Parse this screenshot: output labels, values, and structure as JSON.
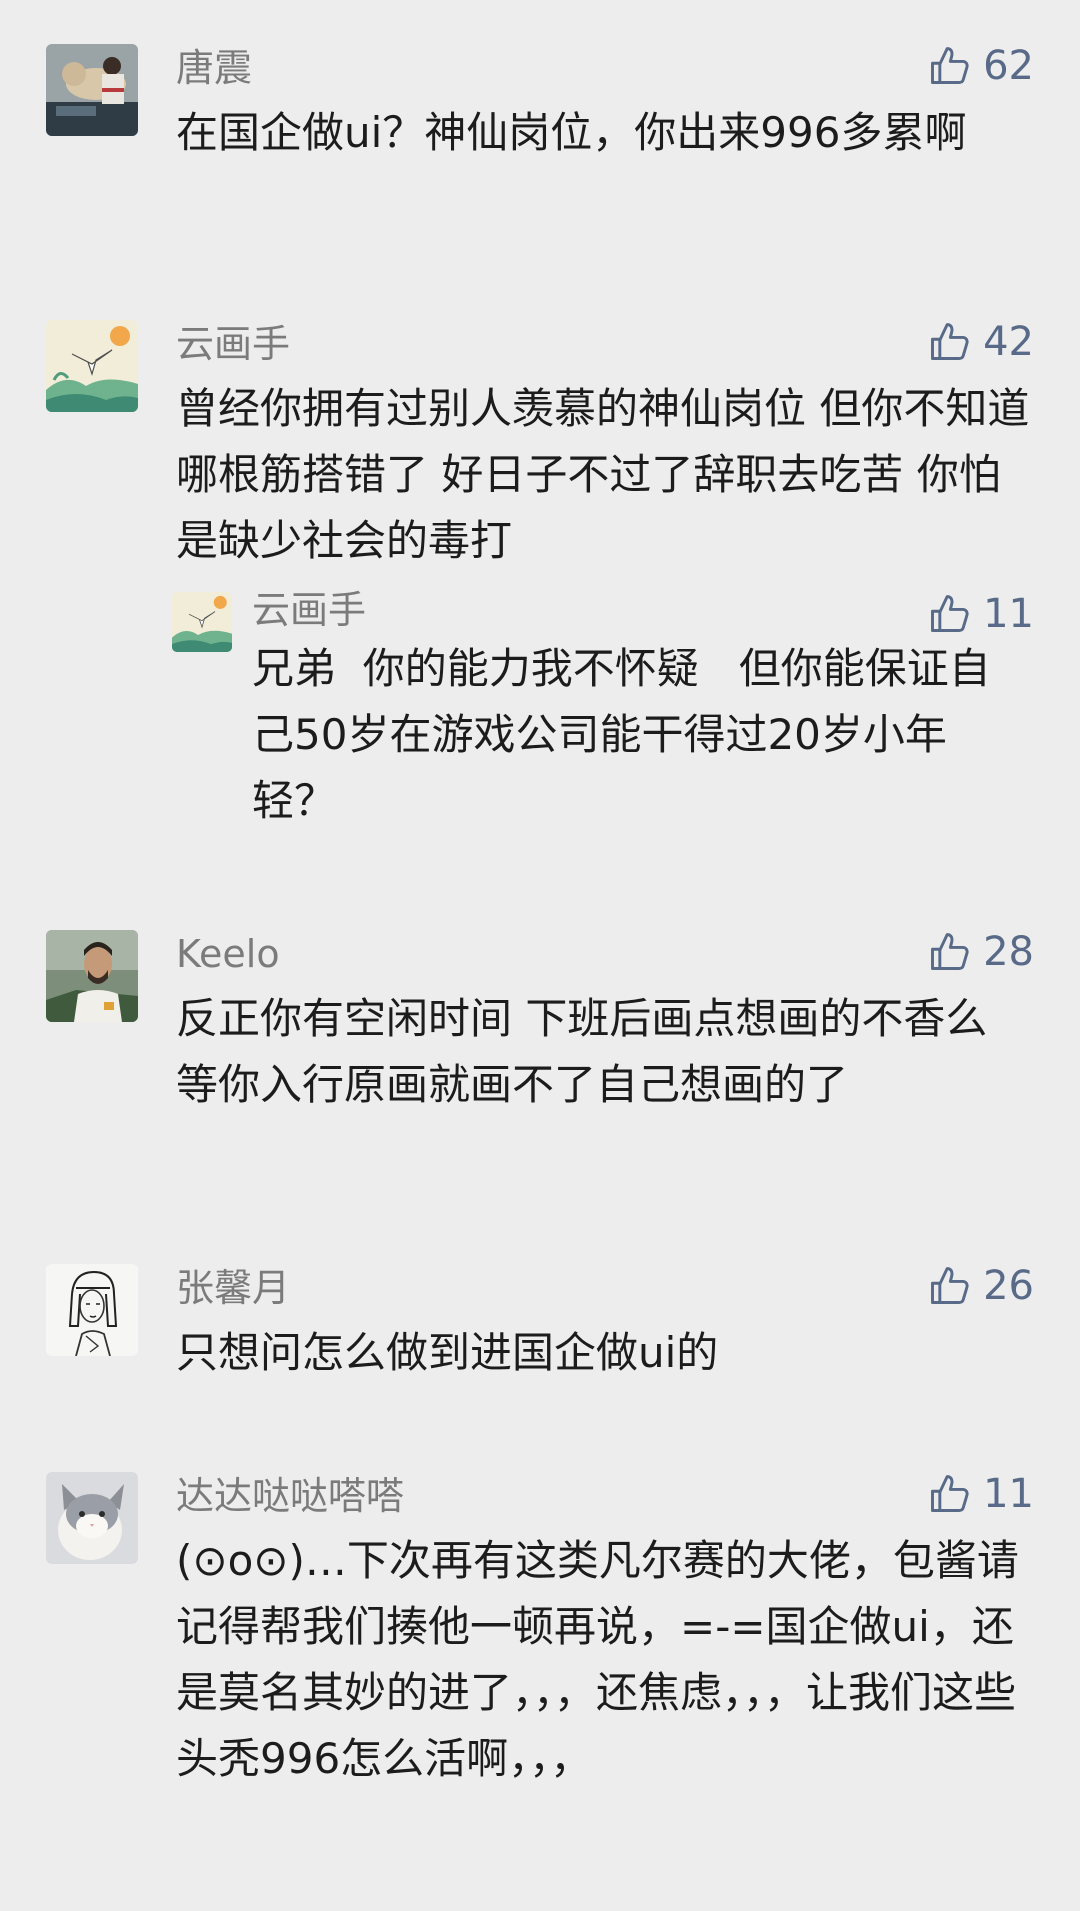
{
  "accent_color": "#586a88",
  "comments": [
    {
      "author": "唐震",
      "likes": "62",
      "text": "在国企做ui？神仙岗位，你出来996多累啊",
      "avatar_icon": "man-with-dog-avatar"
    },
    {
      "author": "云画手",
      "likes": "42",
      "text": "曾经你拥有过别人羡慕的神仙岗位 但你不知道哪根筋搭错了 好日子不过了辞职去吃苦 你怕是缺少社会的毒打",
      "avatar_icon": "crane-painting-avatar"
    },
    {
      "author": "云画手",
      "likes": "11",
      "text": "兄弟  你的能力我不怀疑   但你能保证自己50岁在游戏公司能干得过20岁小年轻？",
      "avatar_icon": "crane-painting-avatar"
    },
    {
      "author": "Keelo",
      "likes": "28",
      "text": "反正你有空闲时间 下班后画点想画的不香么 等你入行原画就画不了自己想画的了",
      "avatar_icon": "bearded-man-avatar"
    },
    {
      "author": "张馨月",
      "likes": "26",
      "text": "只想问怎么做到进国企做ui的",
      "avatar_icon": "sketch-girl-avatar"
    },
    {
      "author": "达达哒哒嗒嗒",
      "likes": "11",
      "text": "(⊙o⊙)…下次再有这类凡尔赛的大佬，包酱请记得帮我们揍他一顿再说，=-=国企做ui，还是莫名其妙的进了，，，还焦虑，，，让我们这些头秃996怎么活啊，，，",
      "avatar_icon": "cat-avatar"
    }
  ]
}
